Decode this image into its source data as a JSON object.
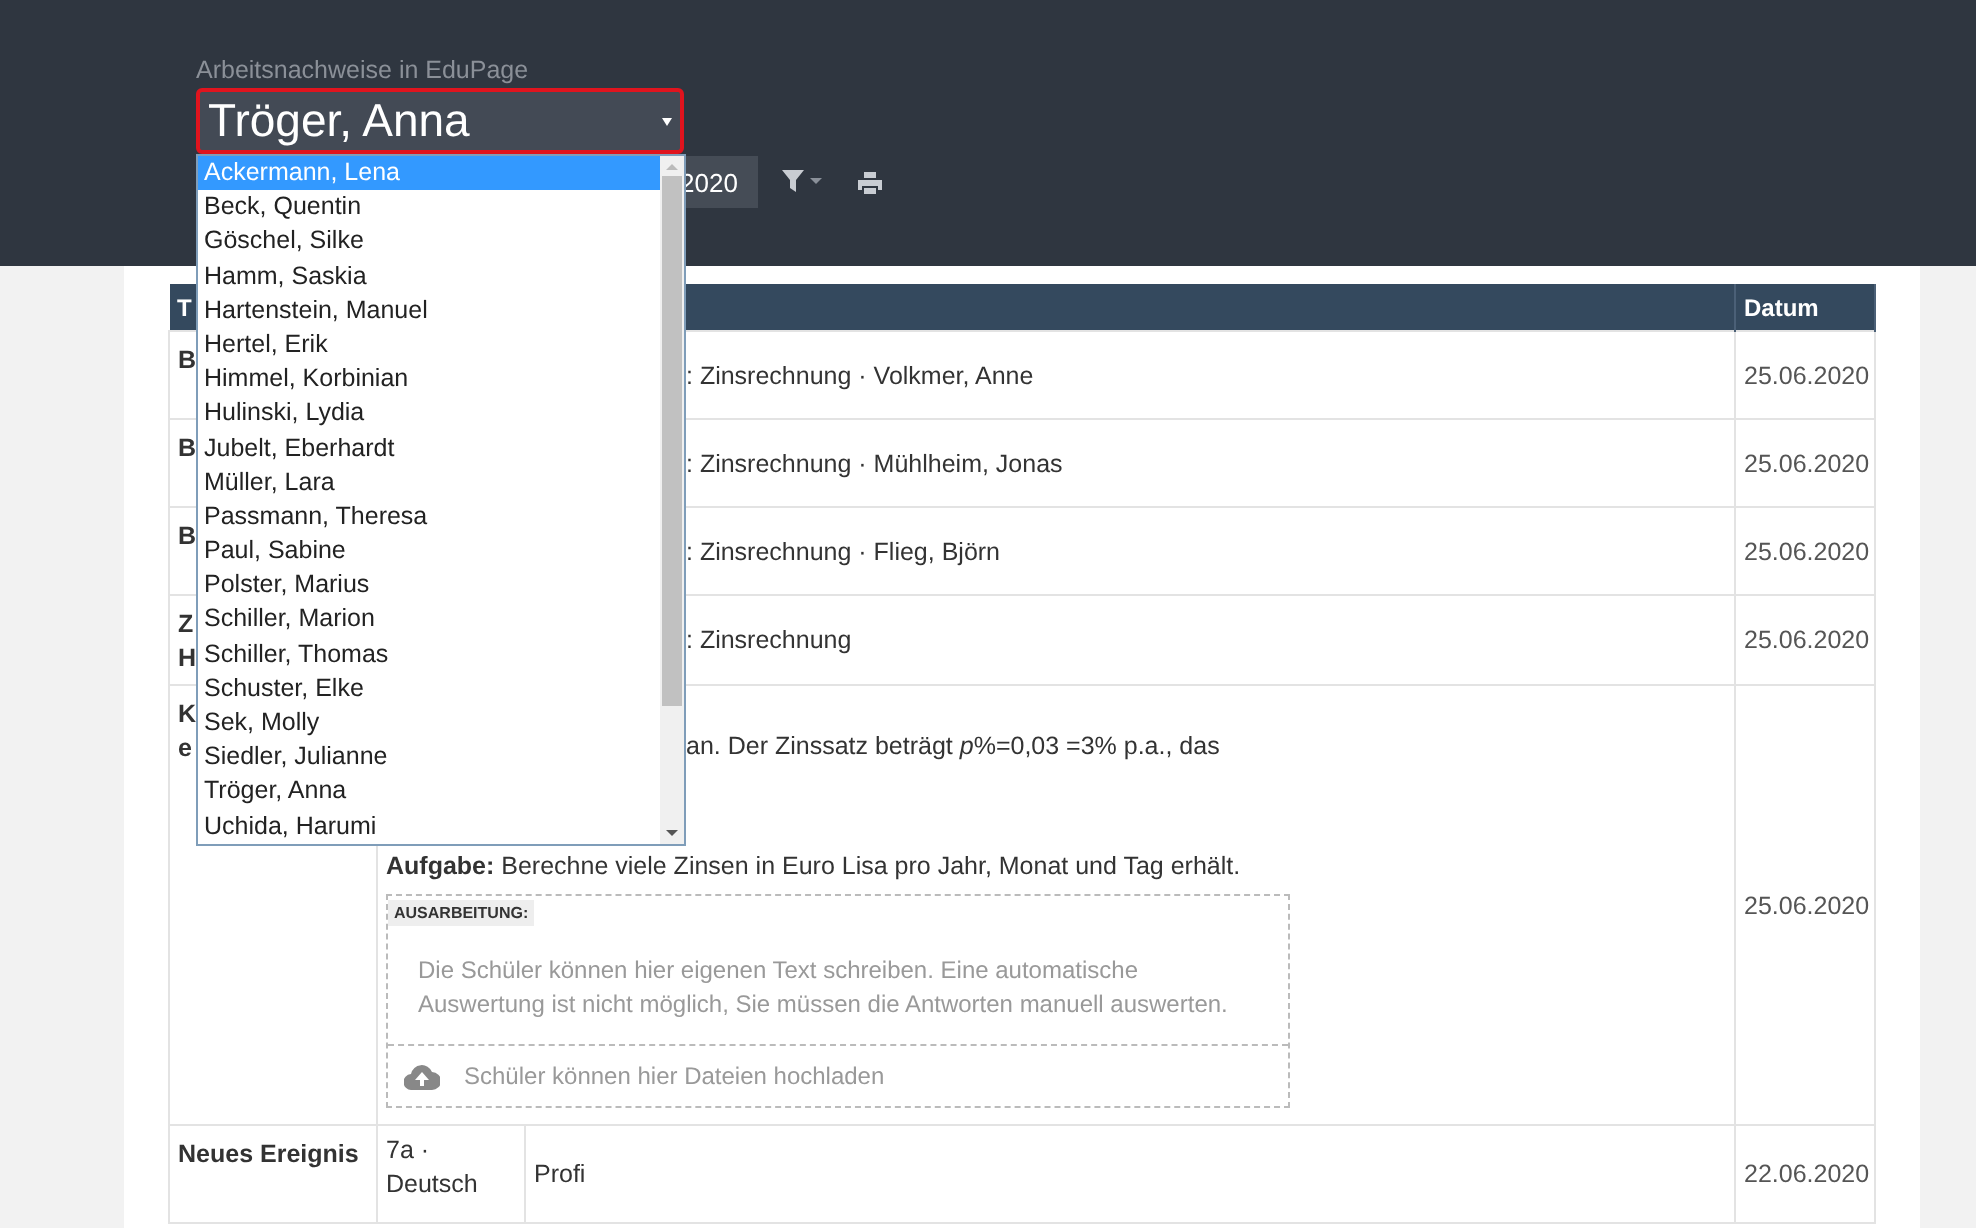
{
  "header": {
    "subtitle": "Arbeitsnachweise in EduPage",
    "student_select": {
      "value": "Tröger, Anna",
      "expanded": true
    },
    "period_button": "2020"
  },
  "student_options": [
    {
      "label": "Ackermann, Lena",
      "selected": true
    },
    {
      "label": "Beck, Quentin",
      "selected": false
    },
    {
      "label": "Göschel, Silke",
      "selected": false
    },
    {
      "label": "Hamm, Saskia",
      "selected": false
    },
    {
      "label": "Hartenstein, Manuel",
      "selected": false
    },
    {
      "label": "Hertel, Erik",
      "selected": false
    },
    {
      "label": "Himmel, Korbinian",
      "selected": false
    },
    {
      "label": "Hulinski, Lydia",
      "selected": false
    },
    {
      "label": "Jubelt, Eberhardt",
      "selected": false
    },
    {
      "label": "Müller, Lara",
      "selected": false
    },
    {
      "label": "Passmann, Theresa",
      "selected": false
    },
    {
      "label": "Paul, Sabine",
      "selected": false
    },
    {
      "label": "Polster, Marius",
      "selected": false
    },
    {
      "label": "Schiller, Marion",
      "selected": false
    },
    {
      "label": "Schiller, Thomas",
      "selected": false
    },
    {
      "label": "Schuster, Elke",
      "selected": false
    },
    {
      "label": "Sek, Molly",
      "selected": false
    },
    {
      "label": "Siedler, Julianne",
      "selected": false
    },
    {
      "label": "Tröger, Anna",
      "selected": false
    },
    {
      "label": "Uchida, Harumi",
      "selected": false
    }
  ],
  "table": {
    "columns": [
      "T",
      "Datum"
    ],
    "rows": [
      {
        "kind": "entry",
        "type": [
          "B"
        ],
        "content": ": Zinsrechnung · Volkmer, Anne",
        "date": "25.06.2020"
      },
      {
        "kind": "entry",
        "type": [
          "B"
        ],
        "content": ": Zinsrechnung · Mühlheim, Jonas",
        "date": "25.06.2020"
      },
      {
        "kind": "entry",
        "type": [
          "B"
        ],
        "content": ": Zinsrechnung · Flieg, Björn",
        "date": "25.06.2020"
      },
      {
        "kind": "entry",
        "type": [
          "Z",
          "H"
        ],
        "content": ": Zinsrechnung",
        "date": "25.06.2020"
      },
      {
        "kind": "task",
        "type": [
          "K",
          "e"
        ],
        "intro": "an. Der Zinssatz beträgt *p*%=0,03 =3% p.a., das",
        "task": "**Aufgabe:** Berechne viele Zinsen in Euro Lisa pro Jahr, Monat und Tag erhält.",
        "work_box": {
          "label": "AUSARBEITUNG:",
          "placeholder": "Die Schüler können hier eigenen Text schreiben. Eine automatische Auswertung ist nicht möglich, Sie müssen die Antworten manuell auswerten.",
          "upload": "Schüler können hier Dateien hochladen"
        },
        "date": "25.06.2020"
      },
      {
        "kind": "event",
        "type": [
          "Neues Ereignis"
        ],
        "class": "7a · Deutsch",
        "content": "Profi",
        "date": "22.06.2020"
      }
    ]
  }
}
